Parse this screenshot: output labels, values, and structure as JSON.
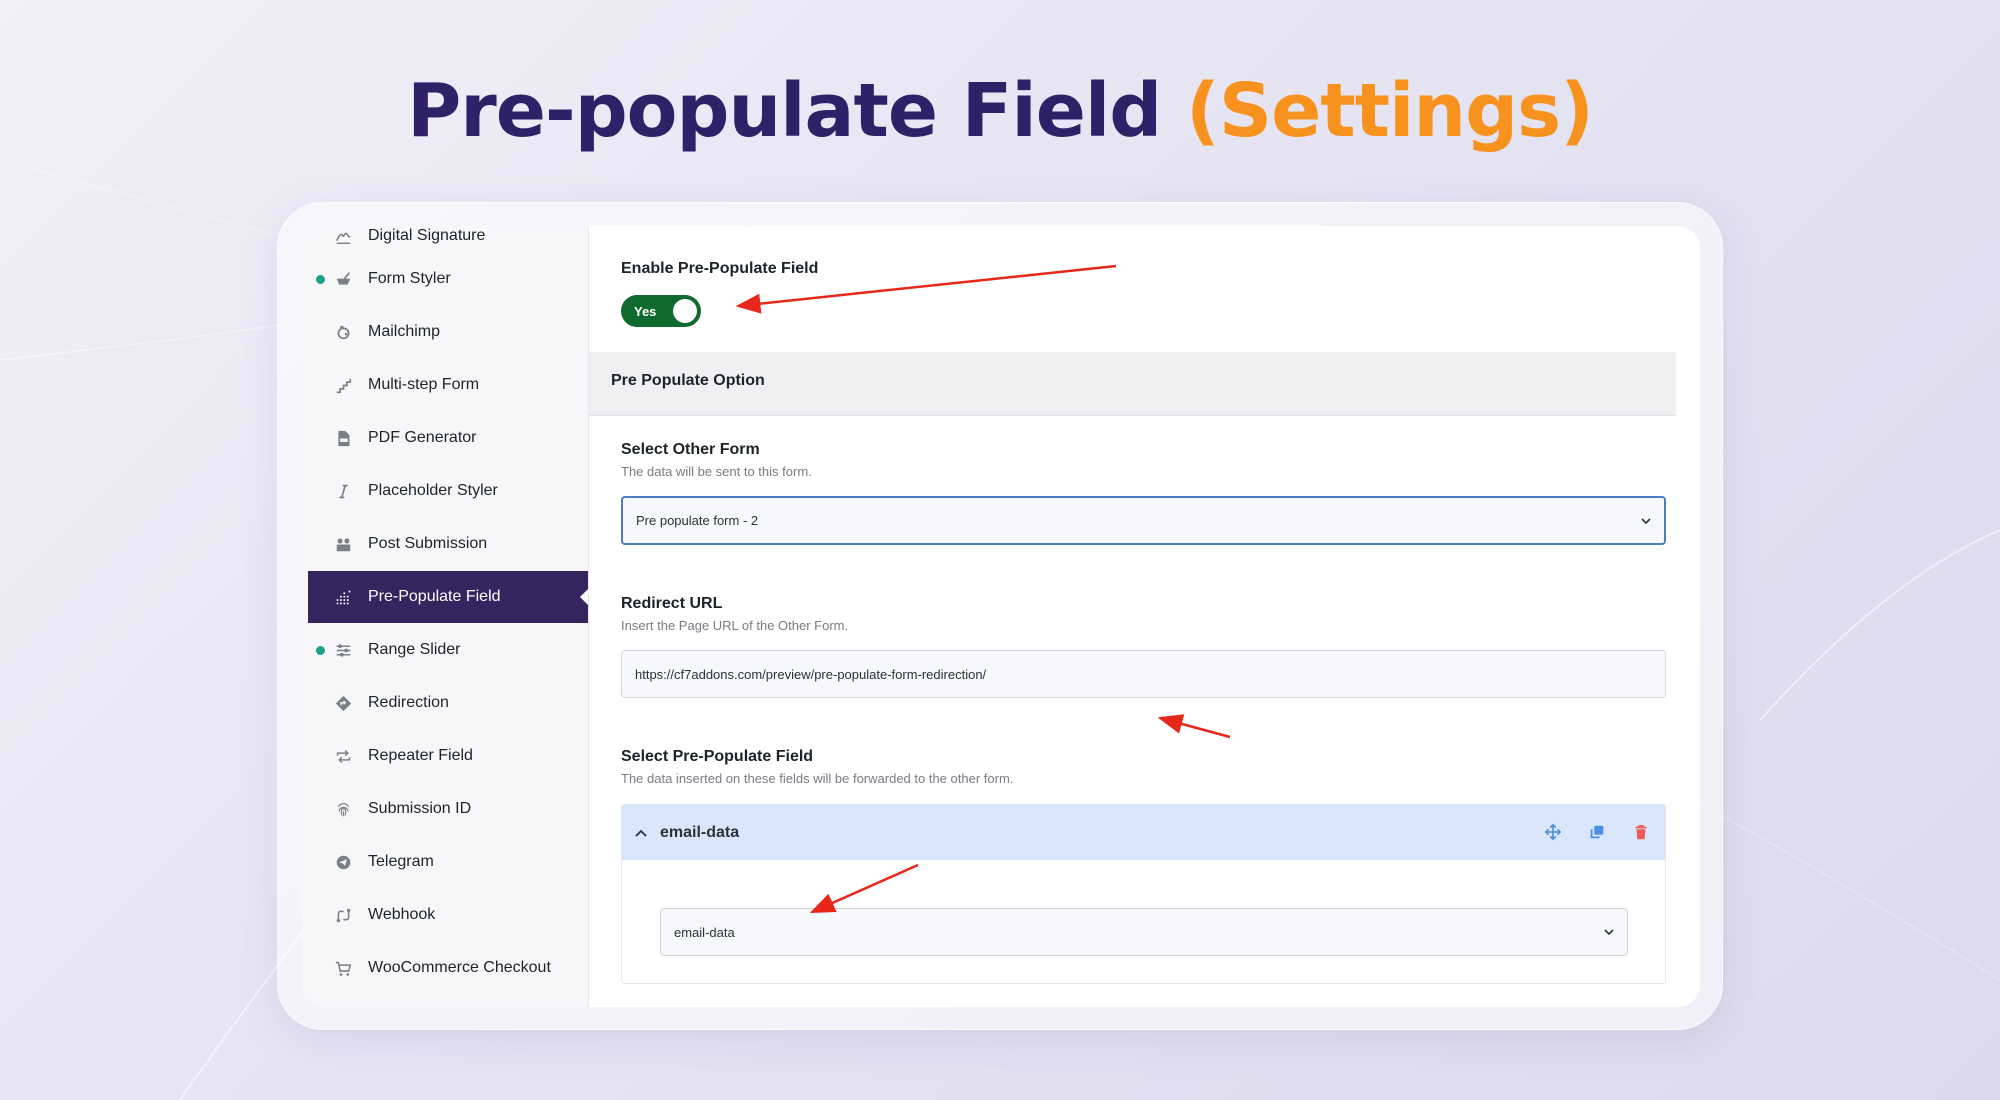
{
  "header": {
    "title_main": "Pre-populate Field",
    "title_accent": "(Settings)"
  },
  "colors": {
    "title": "#2f2168",
    "accent": "#f7921e",
    "sidebar_active": "#35255f",
    "toggle_on": "#0f6a2e",
    "status_dot": "#1aa38a",
    "annotation_arrow": "#e8271b"
  },
  "sidebar": {
    "items": [
      {
        "label": "Digital Signature",
        "icon": "signature-icon",
        "dot": false,
        "active": false
      },
      {
        "label": "Form Styler",
        "icon": "brush-icon",
        "dot": true,
        "active": false
      },
      {
        "label": "Mailchimp",
        "icon": "mailchimp-icon",
        "dot": false,
        "active": false
      },
      {
        "label": "Multi-step Form",
        "icon": "steps-icon",
        "dot": false,
        "active": false
      },
      {
        "label": "PDF Generator",
        "icon": "pdf-icon",
        "dot": false,
        "active": false
      },
      {
        "label": "Placeholder Styler",
        "icon": "italic-icon",
        "dot": false,
        "active": false
      },
      {
        "label": "Post Submission",
        "icon": "post-submission-icon",
        "dot": false,
        "active": false
      },
      {
        "label": "Pre-Populate Field",
        "icon": "prepopulate-icon",
        "dot": false,
        "active": true
      },
      {
        "label": "Range Slider",
        "icon": "sliders-icon",
        "dot": true,
        "active": false
      },
      {
        "label": "Redirection",
        "icon": "redirect-icon",
        "dot": false,
        "active": false
      },
      {
        "label": "Repeater Field",
        "icon": "repeat-icon",
        "dot": false,
        "active": false
      },
      {
        "label": "Submission ID",
        "icon": "fingerprint-icon",
        "dot": false,
        "active": false
      },
      {
        "label": "Telegram",
        "icon": "telegram-icon",
        "dot": false,
        "active": false
      },
      {
        "label": "Webhook",
        "icon": "webhook-icon",
        "dot": false,
        "active": false
      },
      {
        "label": "WooCommerce Checkout",
        "icon": "cart-icon",
        "dot": false,
        "active": false
      }
    ]
  },
  "main": {
    "enable_label": "Enable Pre-Populate Field",
    "toggle_label": "Yes",
    "toggle_on": true,
    "section_title": "Pre Populate Option",
    "other_form": {
      "label": "Select Other Form",
      "description": "The data will be sent to this form.",
      "value": "Pre populate form - 2"
    },
    "redirect": {
      "label": "Redirect URL",
      "description": "Insert the Page URL of the Other Form.",
      "value": "https://cf7addons.com/preview/pre-populate-form-redirection/"
    },
    "prepopulate_field": {
      "label": "Select Pre-Populate Field",
      "description": "The data inserted on these fields will be forwarded to the other form.",
      "item_title": "email-data",
      "item_value": "email-data"
    }
  }
}
